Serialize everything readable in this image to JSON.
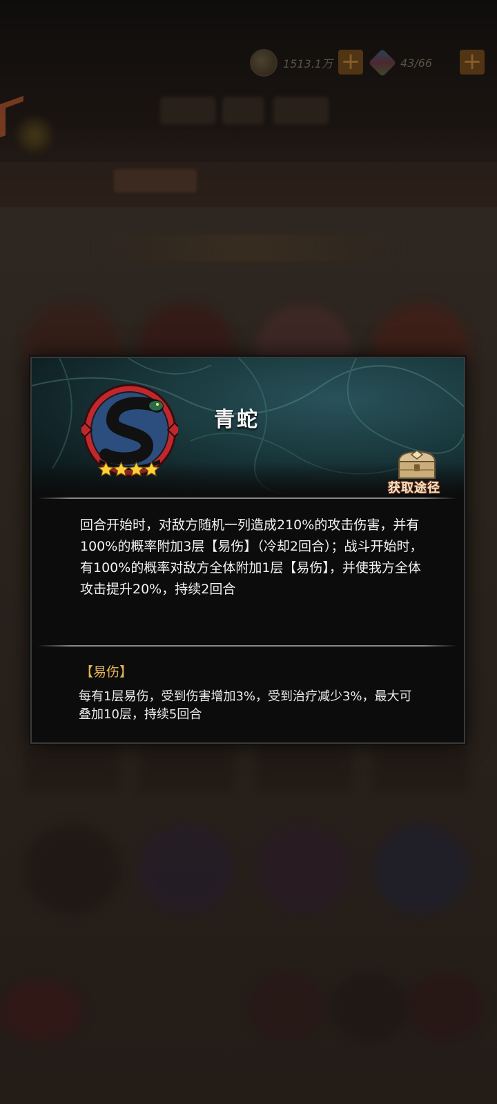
{
  "background": {
    "gold_amount": "1513.1万",
    "gem_amount": "43/66",
    "plus_symbol": "+"
  },
  "modal": {
    "title": "青蛇",
    "star_count": 4,
    "source_label": "获取途径",
    "description": "回合开始时，对敌方随机一列造成210%的攻击伤害，并有100%的概率附加3层【易伤】（冷却2回合）；战斗开始时，有100%的概率对敌方全体附加1层【易伤】，并使我方全体攻击提升20%，持续2回合",
    "keyword_title": "【易伤】",
    "keyword_description": "每有1层易伤，受到伤害增加3%，受到治疗减少3%，最大可叠加10层，持续5回合"
  },
  "icons": {
    "emblem": "snake-emblem-icon",
    "star": "star-icon",
    "source": "treasure-chest-icon",
    "gold": "coin-icon",
    "gem": "gem-icon"
  },
  "colors": {
    "keyword": "#e4b25b",
    "emblem_ring": "#c0282d",
    "snake": "#2c4e7e",
    "star": "#ffd23a"
  }
}
